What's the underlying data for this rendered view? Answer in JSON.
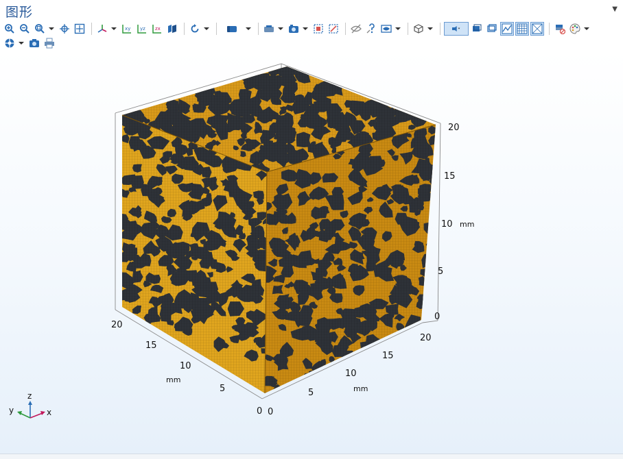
{
  "window": {
    "title": "图形"
  },
  "toolbar_row1": [
    {
      "name": "zoom-in-icon"
    },
    {
      "name": "zoom-out-icon"
    },
    {
      "name": "zoom-box-icon"
    },
    {
      "name": "zoom-extents-icon"
    },
    {
      "name": "move-icon"
    },
    {
      "name": "axis-orientation-icon"
    },
    {
      "name": "view-xy-icon"
    },
    {
      "name": "view-yz-icon"
    },
    {
      "name": "view-zx-icon"
    },
    {
      "name": "view-3d-icon"
    },
    {
      "name": "reset-view-icon"
    },
    {
      "name": "select-box-icon"
    },
    {
      "name": "camera-view-icon"
    },
    {
      "name": "hide-icon"
    },
    {
      "name": "transparency-icon"
    },
    {
      "name": "visibility-icon"
    },
    {
      "name": "layout-icon"
    },
    {
      "name": "render-icon"
    },
    {
      "name": "scene-light-icon"
    },
    {
      "name": "wireframe-icon"
    },
    {
      "name": "grid-icon"
    },
    {
      "name": "color-table-icon"
    },
    {
      "name": "color-palette-icon"
    }
  ],
  "toolbar_row2": [
    {
      "name": "clear-selection-icon"
    },
    {
      "name": "snapshot-camera-icon"
    },
    {
      "name": "print-icon"
    }
  ],
  "axes": {
    "unit": "mm",
    "ticks": [
      "0",
      "5",
      "10",
      "15",
      "20"
    ],
    "labels": {
      "x": "x",
      "y": "y",
      "z": "z"
    }
  },
  "colors": {
    "solid": "#c98a12",
    "solid_light": "#e3a91e",
    "pore": "#2e3238",
    "title": "#2a5a9a",
    "active_tool": "#cfe3f7"
  }
}
